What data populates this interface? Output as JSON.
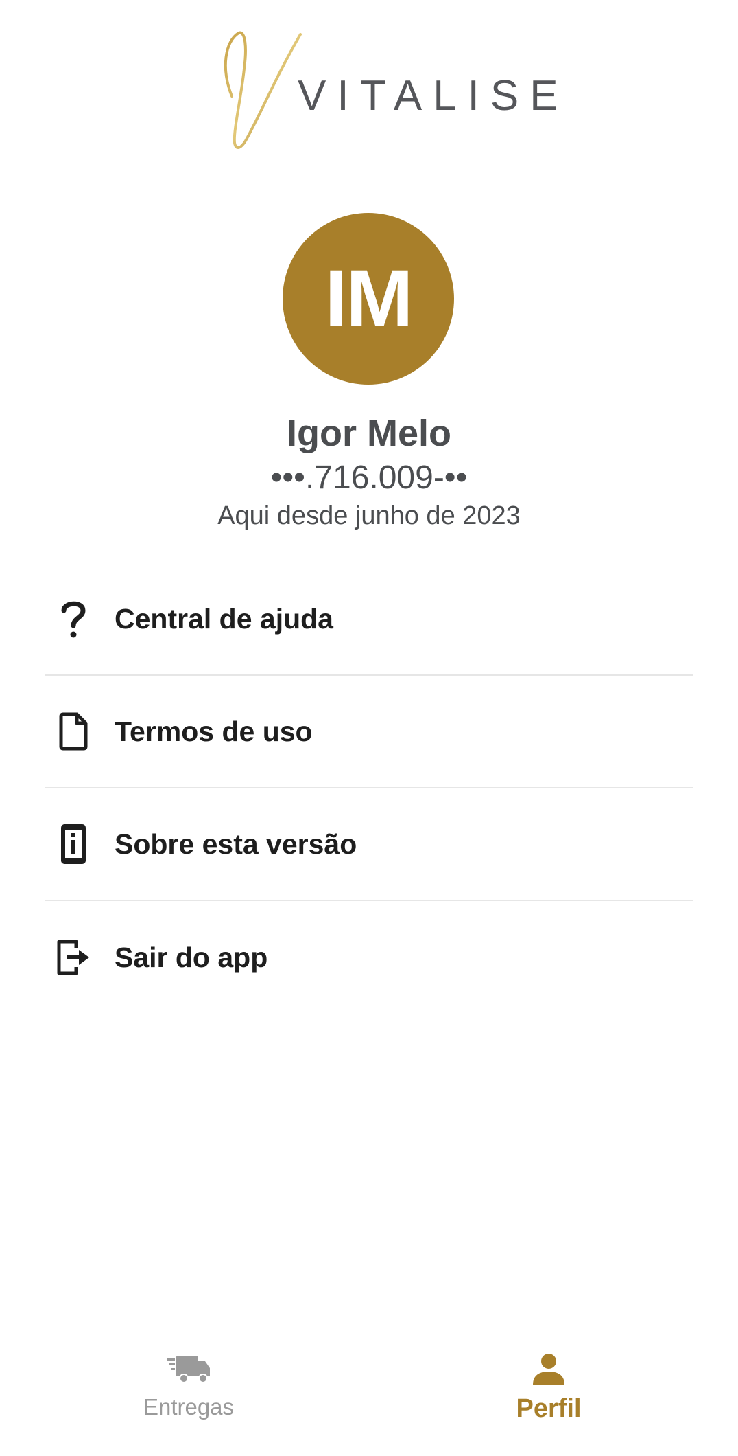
{
  "brand": {
    "logo_text": "VITALISE",
    "accent_color": "#a87f2a"
  },
  "profile": {
    "initials": "IM",
    "name": "Igor Melo",
    "document": "•••.716.009-••",
    "member_since": "Aqui desde junho de 2023"
  },
  "menu": {
    "items": [
      {
        "label": "Central de ajuda",
        "icon": "question-icon"
      },
      {
        "label": "Termos de uso",
        "icon": "document-icon"
      },
      {
        "label": "Sobre esta versão",
        "icon": "info-device-icon"
      },
      {
        "label": "Sair do app",
        "icon": "logout-icon"
      }
    ]
  },
  "bottom_nav": {
    "items": [
      {
        "label": "Entregas",
        "icon": "truck-icon",
        "active": false,
        "color": "#9a9a9a"
      },
      {
        "label": "Perfil",
        "icon": "person-icon",
        "active": true,
        "color": "#a87f2a"
      }
    ]
  }
}
